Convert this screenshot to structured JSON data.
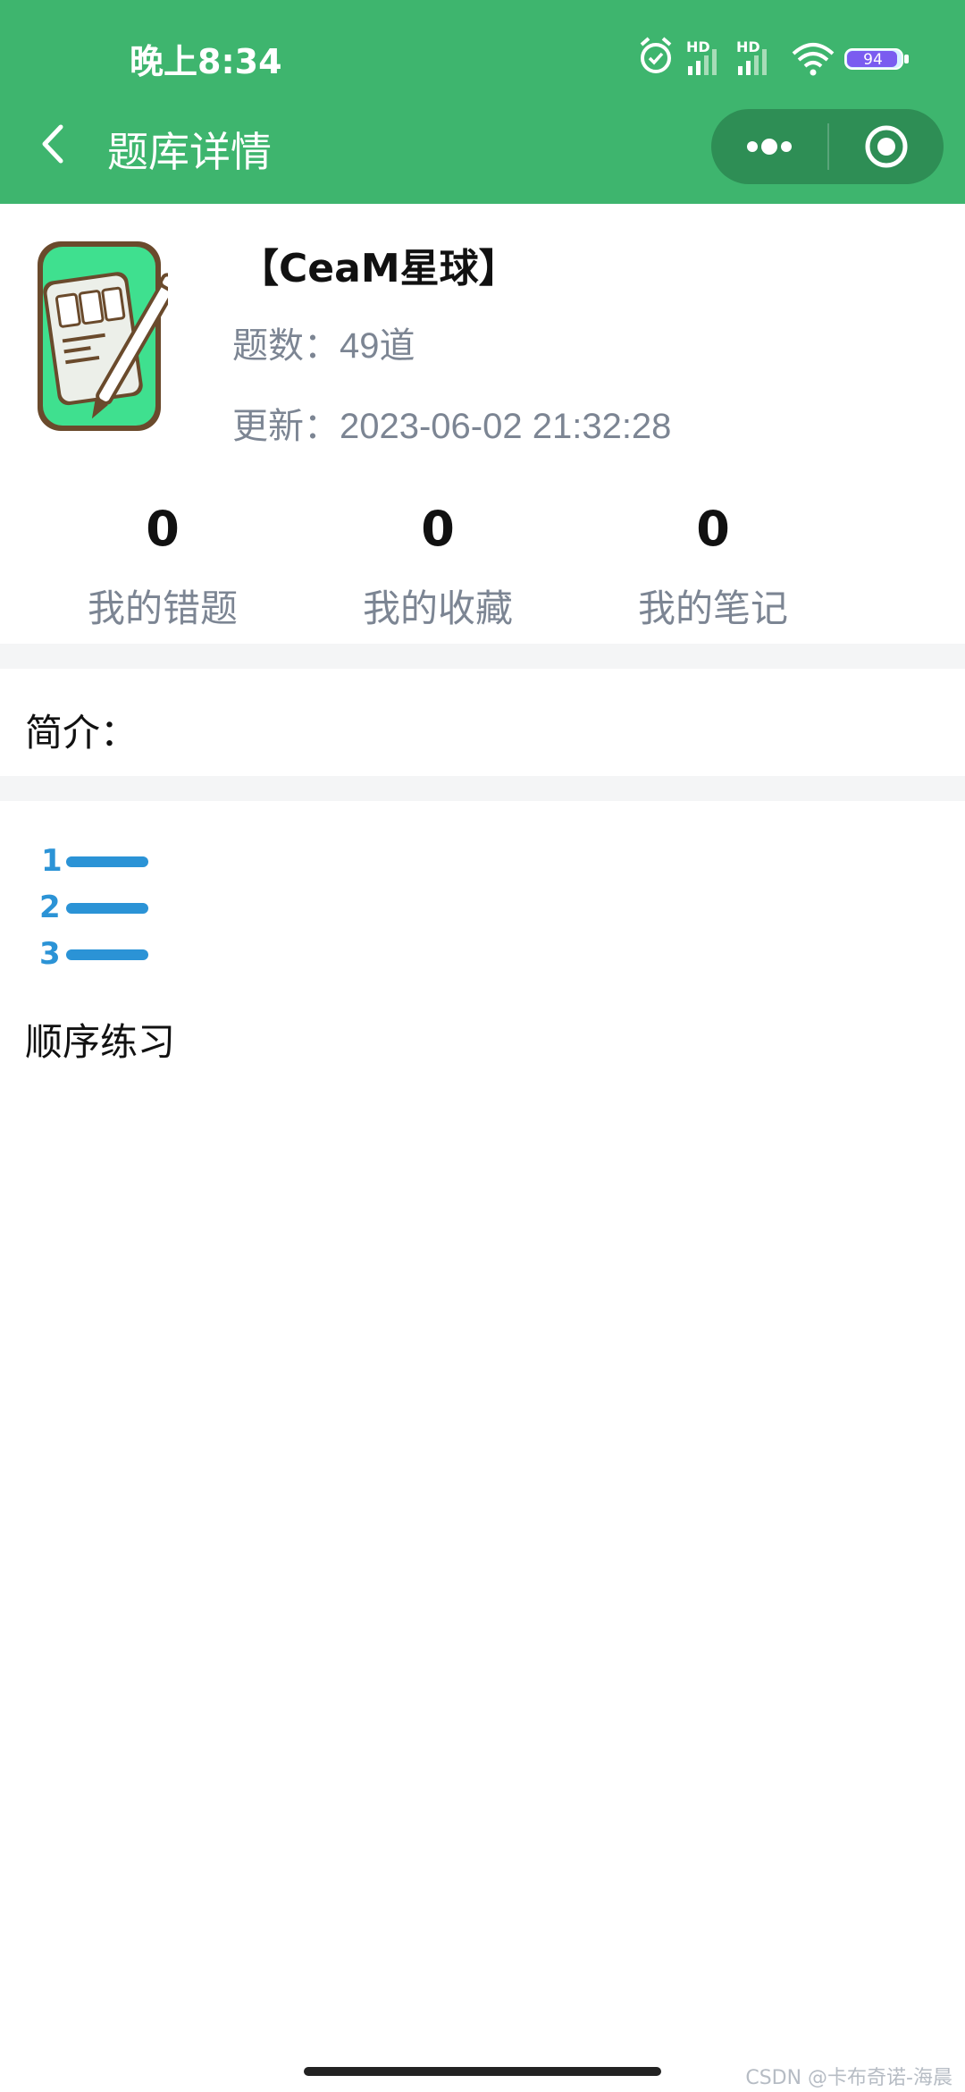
{
  "colors": {
    "header_bg": "#3eb56e",
    "capsule_bg": "#2e8e55",
    "meta_text": "#7c8593",
    "accent_blue": "#2b93d6",
    "band": "#f4f5f6"
  },
  "status_bar": {
    "time": "晚上8:34",
    "signal_label_1": "HD",
    "signal_label_2": "HD",
    "battery": "94",
    "icons": [
      "alarm-icon",
      "signal-icon",
      "signal-icon",
      "wifi-icon",
      "battery-icon"
    ]
  },
  "nav": {
    "title": "题库详情",
    "back_icon": "chevron-left-icon",
    "more_icon": "more-dots-icon",
    "close_icon": "record-target-icon"
  },
  "bank": {
    "icon": "notepad-pen-icon",
    "title": "【CeaM星球】",
    "count_label": "题数：",
    "count_value": "49道",
    "update_label": "更新：",
    "update_value": "2023-06-02 21:32:28"
  },
  "stats": [
    {
      "value": "0",
      "label": "我的错题"
    },
    {
      "value": "0",
      "label": "我的收藏"
    },
    {
      "value": "0",
      "label": "我的笔记"
    }
  ],
  "intro": {
    "label": "简介："
  },
  "practice": {
    "icon": "numbered-list-icon",
    "label": "顺序练习"
  },
  "watermark": "CSDN @卡布奇诺-海晨"
}
